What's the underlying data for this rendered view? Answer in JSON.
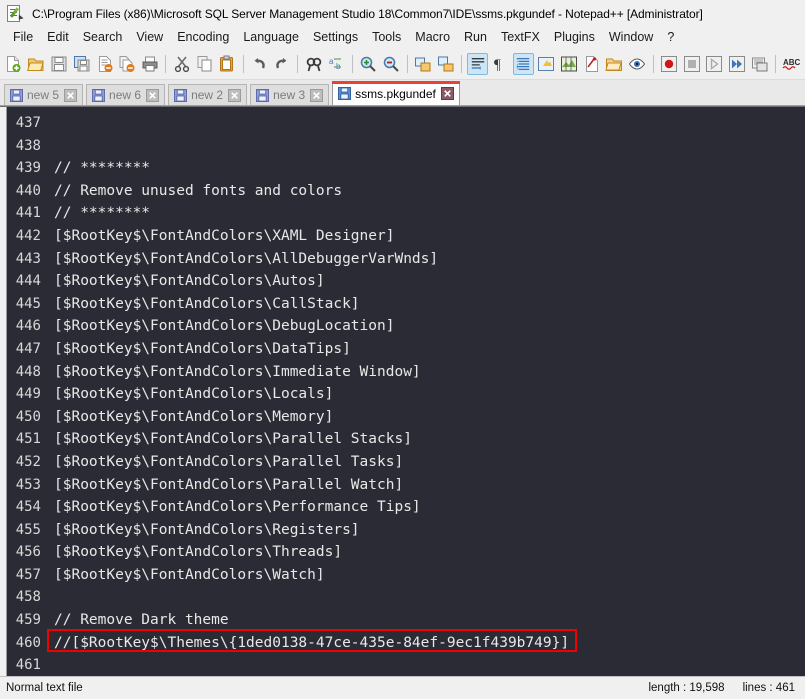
{
  "window": {
    "title": "C:\\Program Files (x86)\\Microsoft SQL Server Management Studio 18\\Common7\\IDE\\ssms.pkgundef - Notepad++ [Administrator]",
    "icon": "notepad-plus-plus-document-icon"
  },
  "menu": {
    "items": [
      {
        "label": "File"
      },
      {
        "label": "Edit"
      },
      {
        "label": "Search"
      },
      {
        "label": "View"
      },
      {
        "label": "Encoding"
      },
      {
        "label": "Language"
      },
      {
        "label": "Settings"
      },
      {
        "label": "Tools"
      },
      {
        "label": "Macro"
      },
      {
        "label": "Run"
      },
      {
        "label": "TextFX"
      },
      {
        "label": "Plugins"
      },
      {
        "label": "Window"
      },
      {
        "label": "?"
      }
    ]
  },
  "toolbar": {
    "buttons": [
      {
        "icon": "new-file-icon"
      },
      {
        "icon": "open-file-icon"
      },
      {
        "icon": "save-icon"
      },
      {
        "icon": "save-all-icon"
      },
      {
        "icon": "close-file-icon"
      },
      {
        "icon": "close-all-files-icon"
      },
      {
        "icon": "print-icon"
      },
      {
        "icon": "separator"
      },
      {
        "icon": "cut-icon"
      },
      {
        "icon": "copy-icon"
      },
      {
        "icon": "paste-icon"
      },
      {
        "icon": "separator"
      },
      {
        "icon": "undo-icon"
      },
      {
        "icon": "redo-icon"
      },
      {
        "icon": "separator"
      },
      {
        "icon": "find-icon"
      },
      {
        "icon": "replace-icon"
      },
      {
        "icon": "separator"
      },
      {
        "icon": "zoom-in-icon"
      },
      {
        "icon": "zoom-out-icon"
      },
      {
        "icon": "separator"
      },
      {
        "icon": "sync-vertical-scroll-icon"
      },
      {
        "icon": "sync-horizontal-scroll-icon"
      },
      {
        "icon": "separator"
      },
      {
        "icon": "word-wrap-icon"
      },
      {
        "icon": "show-all-characters-icon"
      },
      {
        "icon": "indent-guide-icon"
      },
      {
        "icon": "user-defined-language-icon"
      },
      {
        "icon": "document-map-icon"
      },
      {
        "icon": "function-list-icon"
      },
      {
        "icon": "folder-as-workspace-icon"
      },
      {
        "icon": "monitoring-icon"
      },
      {
        "icon": "separator"
      },
      {
        "icon": "record-macro-icon"
      },
      {
        "icon": "stop-recording-icon"
      },
      {
        "icon": "play-macro-icon"
      },
      {
        "icon": "run-macro-multiple-icon"
      },
      {
        "icon": "save-macro-icon"
      },
      {
        "icon": "separator"
      },
      {
        "icon": "spell-check-icon"
      }
    ]
  },
  "tabs": [
    {
      "label": "new 5",
      "active": false
    },
    {
      "label": "new 6",
      "active": false
    },
    {
      "label": "new 2",
      "active": false
    },
    {
      "label": "new 3",
      "active": false
    },
    {
      "label": "ssms.pkgundef",
      "active": true
    }
  ],
  "editor": {
    "background": "#2b2b35",
    "text_color": "#e8e8e8",
    "line_number_color": "#d8d8d8",
    "highlight_color": "#f20000",
    "lines": [
      {
        "number": "437",
        "text": "",
        "highlight": false
      },
      {
        "number": "438",
        "text": "",
        "highlight": false
      },
      {
        "number": "439",
        "text": "// ********",
        "highlight": false
      },
      {
        "number": "440",
        "text": "// Remove unused fonts and colors",
        "highlight": false
      },
      {
        "number": "441",
        "text": "// ********",
        "highlight": false
      },
      {
        "number": "442",
        "text": "[$RootKey$\\FontAndColors\\XAML Designer]",
        "highlight": false
      },
      {
        "number": "443",
        "text": "[$RootKey$\\FontAndColors\\AllDebuggerVarWnds]",
        "highlight": false
      },
      {
        "number": "444",
        "text": "[$RootKey$\\FontAndColors\\Autos]",
        "highlight": false
      },
      {
        "number": "445",
        "text": "[$RootKey$\\FontAndColors\\CallStack]",
        "highlight": false
      },
      {
        "number": "446",
        "text": "[$RootKey$\\FontAndColors\\DebugLocation]",
        "highlight": false
      },
      {
        "number": "447",
        "text": "[$RootKey$\\FontAndColors\\DataTips]",
        "highlight": false
      },
      {
        "number": "448",
        "text": "[$RootKey$\\FontAndColors\\Immediate Window]",
        "highlight": false
      },
      {
        "number": "449",
        "text": "[$RootKey$\\FontAndColors\\Locals]",
        "highlight": false
      },
      {
        "number": "450",
        "text": "[$RootKey$\\FontAndColors\\Memory]",
        "highlight": false
      },
      {
        "number": "451",
        "text": "[$RootKey$\\FontAndColors\\Parallel Stacks]",
        "highlight": false
      },
      {
        "number": "452",
        "text": "[$RootKey$\\FontAndColors\\Parallel Tasks]",
        "highlight": false
      },
      {
        "number": "453",
        "text": "[$RootKey$\\FontAndColors\\Parallel Watch]",
        "highlight": false
      },
      {
        "number": "454",
        "text": "[$RootKey$\\FontAndColors\\Performance Tips]",
        "highlight": false
      },
      {
        "number": "455",
        "text": "[$RootKey$\\FontAndColors\\Registers]",
        "highlight": false
      },
      {
        "number": "456",
        "text": "[$RootKey$\\FontAndColors\\Threads]",
        "highlight": false
      },
      {
        "number": "457",
        "text": "[$RootKey$\\FontAndColors\\Watch]",
        "highlight": false
      },
      {
        "number": "458",
        "text": "",
        "highlight": false
      },
      {
        "number": "459",
        "text": "// Remove Dark theme",
        "highlight": false
      },
      {
        "number": "460",
        "text": "//[$RootKey$\\Themes\\{1ded0138-47ce-435e-84ef-9ec1f439b749}]",
        "highlight": true
      },
      {
        "number": "461",
        "text": "",
        "highlight": false
      }
    ]
  },
  "statusbar": {
    "file_type": "Normal text file",
    "length": "length : 19,598",
    "lines": "lines : 461"
  }
}
